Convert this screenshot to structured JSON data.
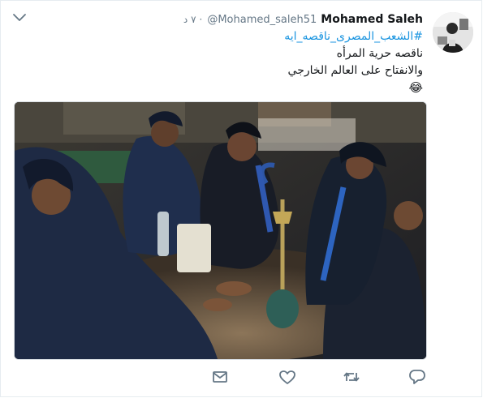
{
  "tweet": {
    "name": "Mohamed Saleh",
    "handle": "@Mohamed_saleh51",
    "time": "٧ د",
    "separator": "·",
    "hashtag": "#الشعب_المصرى_ناقصه_ايه",
    "line1": "ناقصه حرية المرأه",
    "line2": "والانفتاح على العالم الخارجي",
    "emoji": "😂"
  },
  "icons": {
    "caret": "chevron-down-icon",
    "reply": "reply-icon",
    "retweet": "retweet-icon",
    "like": "heart-icon",
    "dm": "envelope-icon"
  },
  "colors": {
    "accent": "#1b95e0",
    "muted": "#657786",
    "text": "#14171a",
    "border": "#e6ecf0"
  }
}
